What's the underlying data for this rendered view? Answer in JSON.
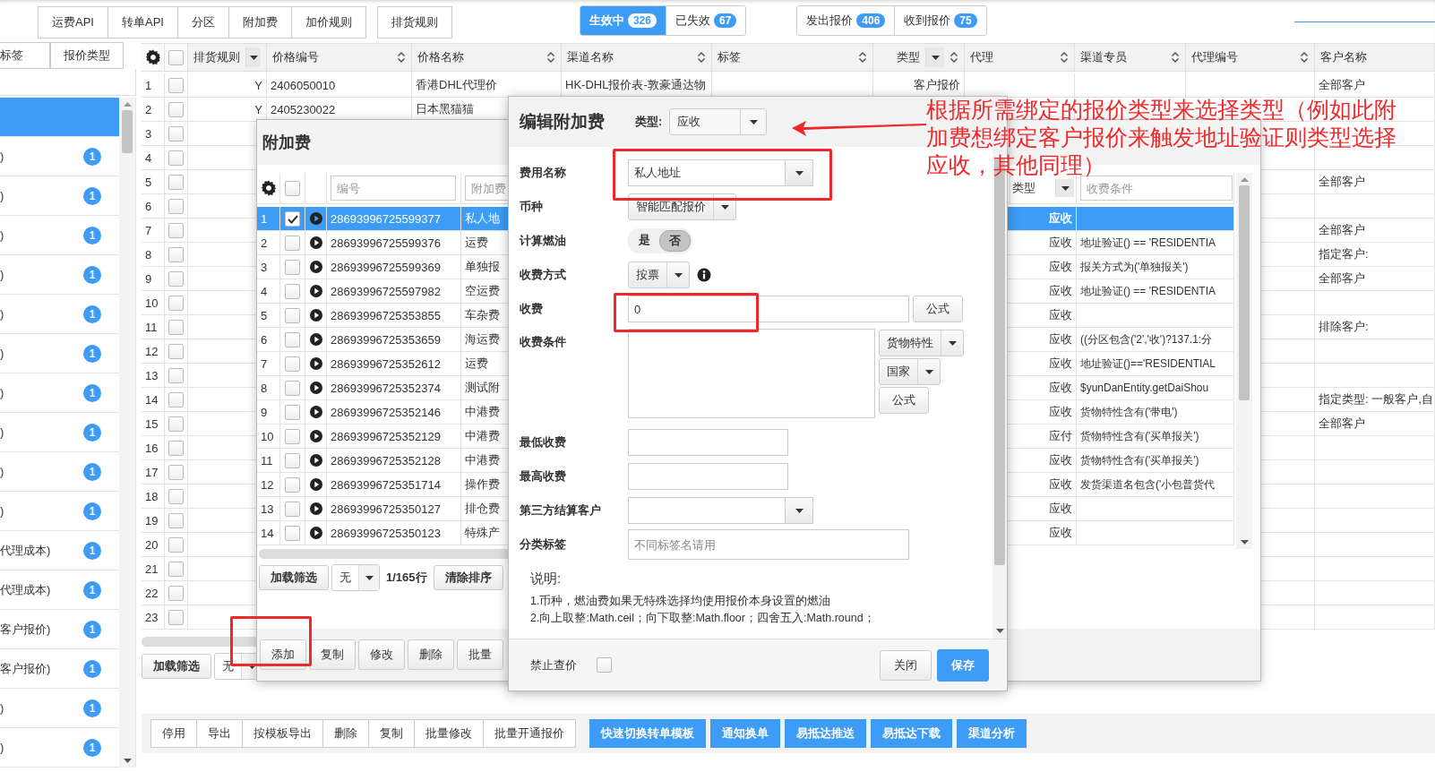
{
  "top_nav": {
    "button_groups": [
      [
        "运费API",
        "转单API",
        "分区",
        "附加费",
        "加价规则"
      ],
      [
        "排货规则"
      ]
    ],
    "status_tabs": [
      {
        "label": "生效中",
        "count": "326",
        "selected": true
      },
      {
        "label": "已失效",
        "count": "67",
        "selected": false
      }
    ],
    "quote_tabs": [
      {
        "label": "发出报价",
        "count": "406",
        "selected": false
      },
      {
        "label": "收到报价",
        "count": "75",
        "selected": false
      }
    ]
  },
  "sidebar": {
    "tabs": [
      "标签",
      "报价类型"
    ],
    "items": [
      {
        "selected": true
      },
      {
        "label": ")",
        "badge": "1",
        "selected": false
      },
      {
        "label": ")",
        "badge": "1",
        "selected": false
      },
      {
        "label": ")",
        "badge": "1",
        "selected": false
      },
      {
        "label": ")",
        "badge": "1",
        "selected": false
      },
      {
        "label": ")",
        "badge": "1",
        "selected": false
      },
      {
        "label": ")",
        "badge": "1",
        "selected": false
      },
      {
        "label": ")",
        "badge": "1",
        "selected": false
      },
      {
        "label": ")",
        "badge": "1",
        "selected": false
      },
      {
        "label": ")",
        "badge": "1",
        "selected": false
      },
      {
        "label": ")",
        "badge": "1",
        "selected": false
      },
      {
        "label": "代理成本)",
        "badge": "1",
        "selected": false
      },
      {
        "label": "代理成本)",
        "badge": "1",
        "selected": false
      },
      {
        "label": "客户报价)",
        "badge": "1",
        "selected": false
      },
      {
        "label": "客户报价)",
        "badge": "1",
        "selected": false
      },
      {
        "label": ")",
        "badge": "1",
        "selected": false
      },
      {
        "label": ")",
        "badge": "1",
        "selected": false
      }
    ]
  },
  "main_grid": {
    "all_checked": false,
    "columns": [
      {
        "label": "排货规则",
        "kind": "dropdown"
      },
      {
        "label": "价格编号",
        "kind": "sort"
      },
      {
        "label": "价格名称",
        "kind": "sort"
      },
      {
        "label": "渠道名称",
        "kind": "sort"
      },
      {
        "label": "标签",
        "kind": "sort"
      },
      {
        "label": "类型",
        "kind": "dropdown_sort"
      },
      {
        "label": "代理",
        "kind": "sort"
      },
      {
        "label": "渠道专员",
        "kind": "sort"
      },
      {
        "label": "代理编号",
        "kind": "sort"
      },
      {
        "label": "客户名称",
        "kind": "plain"
      }
    ],
    "rows": [
      {
        "no": "1",
        "checked": false,
        "rule": "Y",
        "code": "2406050010",
        "name": "香港DHL代理价",
        "channel": "HK-DHL报价表-敦豪通达物",
        "type": "客户报价",
        "customer": "全部客户"
      },
      {
        "no": "2",
        "checked": false,
        "rule": "Y",
        "code": "2405230022",
        "name": "日本黑猫猫"
      },
      {
        "no": "3",
        "checked": false
      },
      {
        "no": "4",
        "checked": false
      },
      {
        "no": "5",
        "checked": false,
        "customer": "全部客户"
      },
      {
        "no": "6",
        "checked": false
      },
      {
        "no": "7",
        "checked": false,
        "customer": "全部客户"
      },
      {
        "no": "8",
        "checked": false,
        "customer": "指定客户:"
      },
      {
        "no": "9",
        "checked": false,
        "customer": "全部客户"
      },
      {
        "no": "10",
        "checked": false
      },
      {
        "no": "11",
        "checked": false,
        "customer": "排除客户:"
      },
      {
        "no": "12",
        "checked": false
      },
      {
        "no": "13",
        "checked": false
      },
      {
        "no": "14",
        "checked": false,
        "customer": "指定类型: 一般客户,自"
      },
      {
        "no": "15",
        "checked": false,
        "customer": "全部客户"
      },
      {
        "no": "16",
        "checked": false
      },
      {
        "no": "17",
        "checked": false
      },
      {
        "no": "18",
        "checked": false
      },
      {
        "no": "19",
        "checked": false
      },
      {
        "no": "20",
        "checked": false
      },
      {
        "no": "21",
        "checked": false
      },
      {
        "no": "22",
        "checked": false
      },
      {
        "no": "23",
        "checked": false
      }
    ],
    "toolbar": {
      "load": "加载筛选",
      "preset": "无"
    }
  },
  "bottom_actions": [
    {
      "label": "停用",
      "kind": "default"
    },
    {
      "label": "导出",
      "kind": "default"
    },
    {
      "label": "按模板导出",
      "kind": "default"
    },
    {
      "label": "删除",
      "kind": "default"
    },
    {
      "label": "复制",
      "kind": "default"
    },
    {
      "label": "批量修改",
      "kind": "default"
    },
    {
      "label": "批量开通报价",
      "kind": "default"
    },
    {
      "label": "快速切换转单模板",
      "kind": "primary"
    },
    {
      "label": "通知换单",
      "kind": "primary"
    },
    {
      "label": "易抵达推送",
      "kind": "primary"
    },
    {
      "label": "易抵达下载",
      "kind": "primary"
    },
    {
      "label": "渠道分析",
      "kind": "primary"
    }
  ],
  "fee_window": {
    "title": "附加费",
    "all_checked": false,
    "id_filter": {
      "placeholder": "编号"
    },
    "name_filter": {
      "placeholder": "附加费"
    },
    "type_header": "类型",
    "condition_filter": {
      "placeholder": "收费条件"
    },
    "rows": [
      {
        "no": "1",
        "id": "28693996725599377",
        "name": "私人地",
        "type": "应收",
        "checked": true,
        "selected": true
      },
      {
        "no": "2",
        "id": "28693996725599376",
        "name": "运费",
        "type": "应收",
        "condition": "地址验证() == 'RESIDENTIA",
        "checked": false,
        "selected": false
      },
      {
        "no": "3",
        "id": "28693996725599369",
        "name": "单独报",
        "type": "应收",
        "condition": "报关方式为('单独报关')",
        "checked": false,
        "selected": false
      },
      {
        "no": "4",
        "id": "28693996725597982",
        "name": "空运费",
        "type": "应收",
        "condition": "地址验证() == 'RESIDENTIA",
        "checked": false,
        "selected": false
      },
      {
        "no": "5",
        "id": "28693996725353855",
        "name": "车杂费",
        "type": "应收",
        "checked": false,
        "selected": false
      },
      {
        "no": "6",
        "id": "28693996725353659",
        "name": "海运费",
        "type": "应收",
        "condition": "((分区包含('2','收')?137.1:分",
        "checked": false,
        "selected": false
      },
      {
        "no": "7",
        "id": "28693996725352612",
        "name": "运费",
        "type": "应收",
        "condition": "地址验证()=='RESIDENTIAL",
        "checked": false,
        "selected": false
      },
      {
        "no": "8",
        "id": "28693996725352374",
        "name": "测试附",
        "type": "应收",
        "condition": "$yunDanEntity.getDaiShou",
        "checked": false,
        "selected": false
      },
      {
        "no": "9",
        "id": "28693996725352146",
        "name": "中港费",
        "type": "应收",
        "condition": "货物特性含有('带电')",
        "checked": false,
        "selected": false
      },
      {
        "no": "10",
        "id": "28693996725352129",
        "name": "中港费",
        "type": "应付",
        "condition": "货物特性含有('买单报关')",
        "checked": false,
        "selected": false
      },
      {
        "no": "11",
        "id": "28693996725352128",
        "name": "中港费",
        "type": "应收",
        "condition": "货物特性含有('买单报关')",
        "checked": false,
        "selected": false
      },
      {
        "no": "12",
        "id": "28693996725351714",
        "name": "操作费",
        "type": "应收",
        "condition": "发货渠道名包含('小包普货代",
        "checked": false,
        "selected": false
      },
      {
        "no": "13",
        "id": "28693996725350127",
        "name": "排仓费",
        "type": "应收",
        "checked": false,
        "selected": false
      },
      {
        "no": "14",
        "id": "28693996725350123",
        "name": "特殊产",
        "type": "应收",
        "checked": false,
        "selected": false
      }
    ],
    "toolbar": {
      "load": "加载筛选",
      "preset": "无",
      "count": "1/165行",
      "clear": "清除排序"
    },
    "buttons": [
      {
        "label": "添加",
        "highlighted": true
      },
      {
        "label": "复制",
        "highlighted": false
      },
      {
        "label": "修改",
        "highlighted": false
      },
      {
        "label": "删除",
        "highlighted": false
      },
      {
        "label": "批量",
        "highlighted": false
      }
    ]
  },
  "edit_dialog": {
    "title": "编辑附加费",
    "type_label": "类型:",
    "type_value": "应收",
    "fields": [
      {
        "kind": "select",
        "label": "费用名称",
        "value": "私人地址",
        "highlighted": true
      },
      {
        "kind": "dropdown",
        "label": "币种",
        "value": "智能匹配报价",
        "info": false
      },
      {
        "kind": "toggle",
        "label": "计算燃油",
        "options": [
          {
            "label": "是",
            "selected": false
          },
          {
            "label": "否",
            "selected": true
          }
        ]
      },
      {
        "kind": "dropdown",
        "label": "收费方式",
        "value": "按票",
        "info": true
      },
      {
        "kind": "formula_input",
        "label": "收费",
        "value": "0",
        "button": "公式",
        "highlighted": true
      },
      {
        "kind": "textarea",
        "label": "收费条件",
        "buttons": [
          {
            "label": "货物特性",
            "caret": true
          },
          {
            "label": "国家",
            "caret": true
          },
          {
            "label": "公式",
            "caret": false
          }
        ]
      },
      {
        "kind": "input",
        "label": "最低收费"
      },
      {
        "kind": "input",
        "label": "最高收费"
      },
      {
        "kind": "select",
        "label": "第三方结算客户",
        "highlighted": false
      },
      {
        "kind": "text_input",
        "label": "分类标签",
        "placeholder": "不同标签名请用"
      }
    ],
    "notes_title": "说明:",
    "notes": [
      "1.币种，燃油费如果无特殊选择均使用报价本身设置的燃油",
      "2.向上取整:Math.ceil；向下取整:Math.floor；四舍五入:Math.round；"
    ],
    "footer": {
      "checkbox_label": "禁止查价",
      "checked": false,
      "buttons": [
        {
          "label": "关闭",
          "kind": "default"
        },
        {
          "label": "保存",
          "kind": "primary"
        }
      ]
    }
  },
  "annotation": {
    "lines": [
      "根据所需绑定的报价类型来选择类型（例如此附",
      "加费想绑定客户报价来触发地址验证则类型选择",
      "应收，其他同理）"
    ],
    "arrow": true
  }
}
